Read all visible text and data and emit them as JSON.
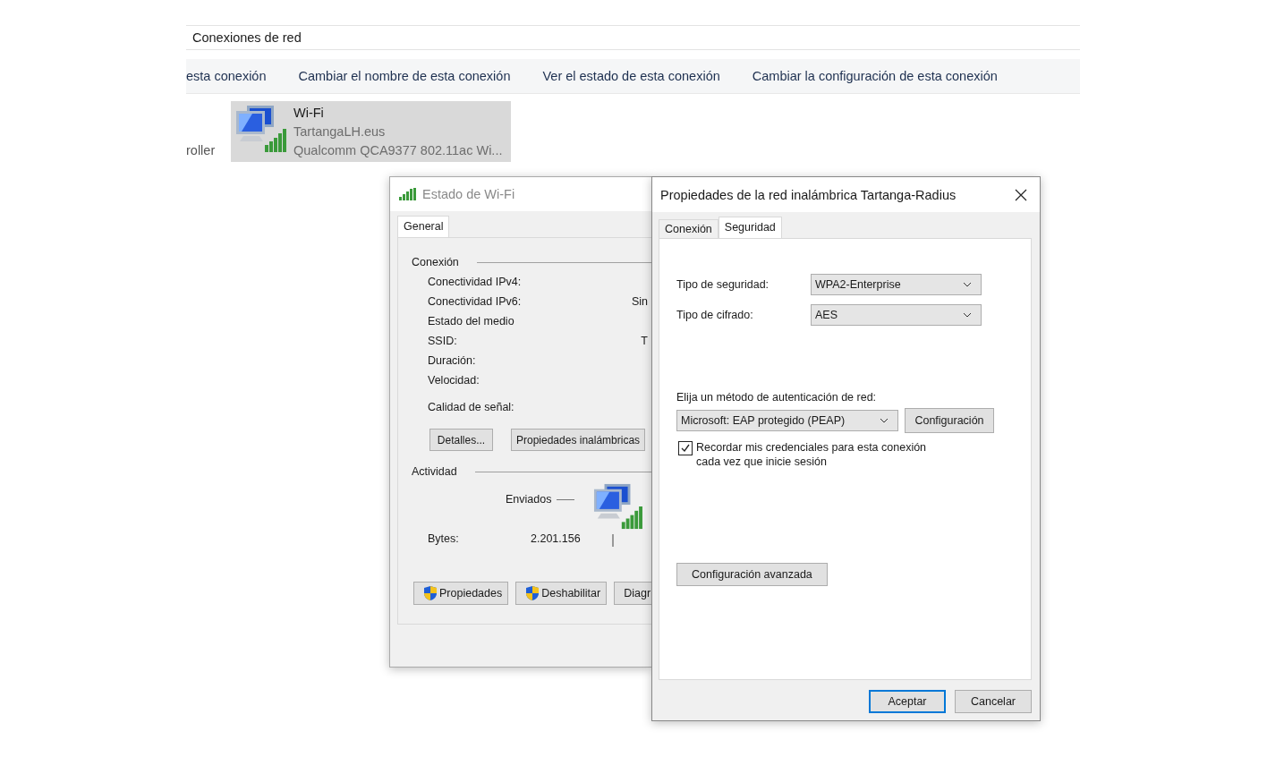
{
  "explorer": {
    "address": "Conexiones de red",
    "toolbar": [
      "esta conexión",
      "Cambiar el nombre de esta conexión",
      "Ver el estado de esta conexión",
      "Cambiar la configuración de esta conexión"
    ],
    "partial_adapter": "roller",
    "adapter": {
      "name": "Wi-Fi",
      "network": "TartangaLH.eus",
      "device": "Qualcomm QCA9377 802.11ac Wi...",
      "selected": true
    }
  },
  "status_window": {
    "title": "Estado de Wi-Fi",
    "active": false,
    "tabs": [
      {
        "label": "General",
        "selected": true
      }
    ],
    "connection": {
      "heading": "Conexión",
      "rows": [
        {
          "label": "Conectividad IPv4:"
        },
        {
          "label": "Conectividad IPv6:",
          "value": "Sin"
        },
        {
          "label": "Estado del medio"
        },
        {
          "label": "SSID:",
          "value": "T"
        },
        {
          "label": "Duración:"
        },
        {
          "label": "Velocidad:"
        }
      ],
      "signal_label": "Calidad de señal:",
      "buttons": [
        "Detalles...",
        "Propiedades inalámbricas"
      ]
    },
    "activity": {
      "heading": "Actividad",
      "sent_label": "Enviados",
      "bytes_label": "Bytes:",
      "bytes_sent": "2.201.156"
    },
    "buttons": [
      {
        "label": "Propiedades",
        "shield": true
      },
      {
        "label": "Deshabilitar",
        "shield": true
      },
      {
        "label": "Diagr",
        "shield": false
      }
    ]
  },
  "properties_window": {
    "title": "Propiedades de la red inalámbrica Tartanga-Radius",
    "active": true,
    "tabs": [
      {
        "label": "Conexión",
        "selected": false
      },
      {
        "label": "Seguridad",
        "selected": true
      }
    ],
    "fields": [
      {
        "label": "Tipo de seguridad:",
        "value": "WPA2-Enterprise"
      },
      {
        "label": "Tipo de cifrado:",
        "value": "AES"
      }
    ],
    "auth": {
      "label": "Elija un método de autenticación de red:",
      "value": "Microsoft: EAP protegido (PEAP)",
      "button": "Configuración"
    },
    "remember": {
      "label": "Recordar mis credenciales para esta conexión cada vez que inicie sesión",
      "checked": true
    },
    "advanced_button": "Configuración avanzada",
    "buttons": [
      {
        "label": "Aceptar",
        "default": true
      },
      {
        "label": "Cancelar",
        "default": false
      }
    ]
  }
}
